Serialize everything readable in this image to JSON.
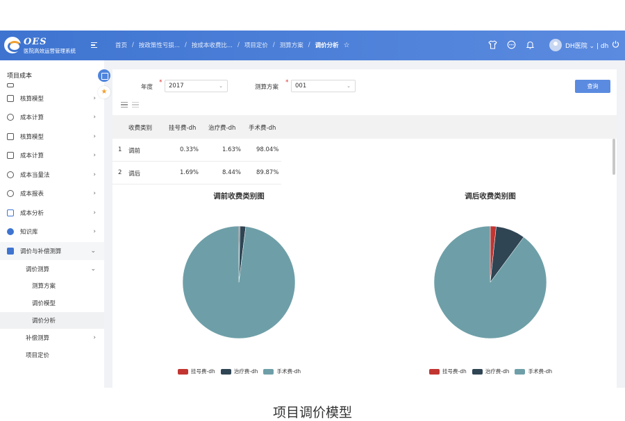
{
  "app": {
    "logo_title": "OES",
    "logo_subtitle": "医院高效运营管理系统"
  },
  "breadcrumb": [
    "首页",
    "按政策性亏损...",
    "按成本收费比...",
    "项目定价",
    "测算方案",
    "调价分析"
  ],
  "user": {
    "name": "DH医院 ⌄ | dh"
  },
  "sidebar": {
    "title": "项目成本",
    "items": [
      {
        "label": "核算模型"
      },
      {
        "label": "成本计算"
      },
      {
        "label": "核算模型"
      },
      {
        "label": "成本计算"
      },
      {
        "label": "成本当量法"
      },
      {
        "label": "成本报表"
      },
      {
        "label": "成本分析"
      },
      {
        "label": "知识库"
      },
      {
        "label": "调价与补偿测算"
      }
    ],
    "sub": {
      "group1": "调价测算",
      "group1_items": [
        "测算方案",
        "调价模型",
        "调价分析"
      ],
      "group2": "补偿测算",
      "group3": "项目定价"
    }
  },
  "filters": {
    "year_label": "年度",
    "year_value": "2017",
    "plan_label": "测算方案",
    "plan_value": "001",
    "query": "查询"
  },
  "table": {
    "headers": [
      "收费类别",
      "挂号费-dh",
      "治疗费-dh",
      "手术费-dh"
    ],
    "rows": [
      {
        "idx": "1",
        "cat": "调前",
        "a": "0.33%",
        "b": "1.63%",
        "c": "98.04%"
      },
      {
        "idx": "2",
        "cat": "调后",
        "a": "1.69%",
        "b": "8.44%",
        "c": "89.87%"
      }
    ]
  },
  "chart_data": [
    {
      "type": "pie",
      "title": "调前收费类别图",
      "labels": [
        "挂号费-dh",
        "治疗费-dh",
        "手术费-dh"
      ],
      "values": [
        0.33,
        1.63,
        98.04
      ],
      "colors": [
        "#c23531",
        "#2f4554",
        "#6e9fa8"
      ],
      "legend": "bottom"
    },
    {
      "type": "pie",
      "title": "调后收费类别图",
      "labels": [
        "挂号费-dh",
        "治疗费-dh",
        "手术费-dh"
      ],
      "values": [
        1.69,
        8.44,
        89.87
      ],
      "colors": [
        "#c23531",
        "#2f4554",
        "#6e9fa8"
      ],
      "legend": "bottom"
    }
  ],
  "caption": "项目调价模型"
}
